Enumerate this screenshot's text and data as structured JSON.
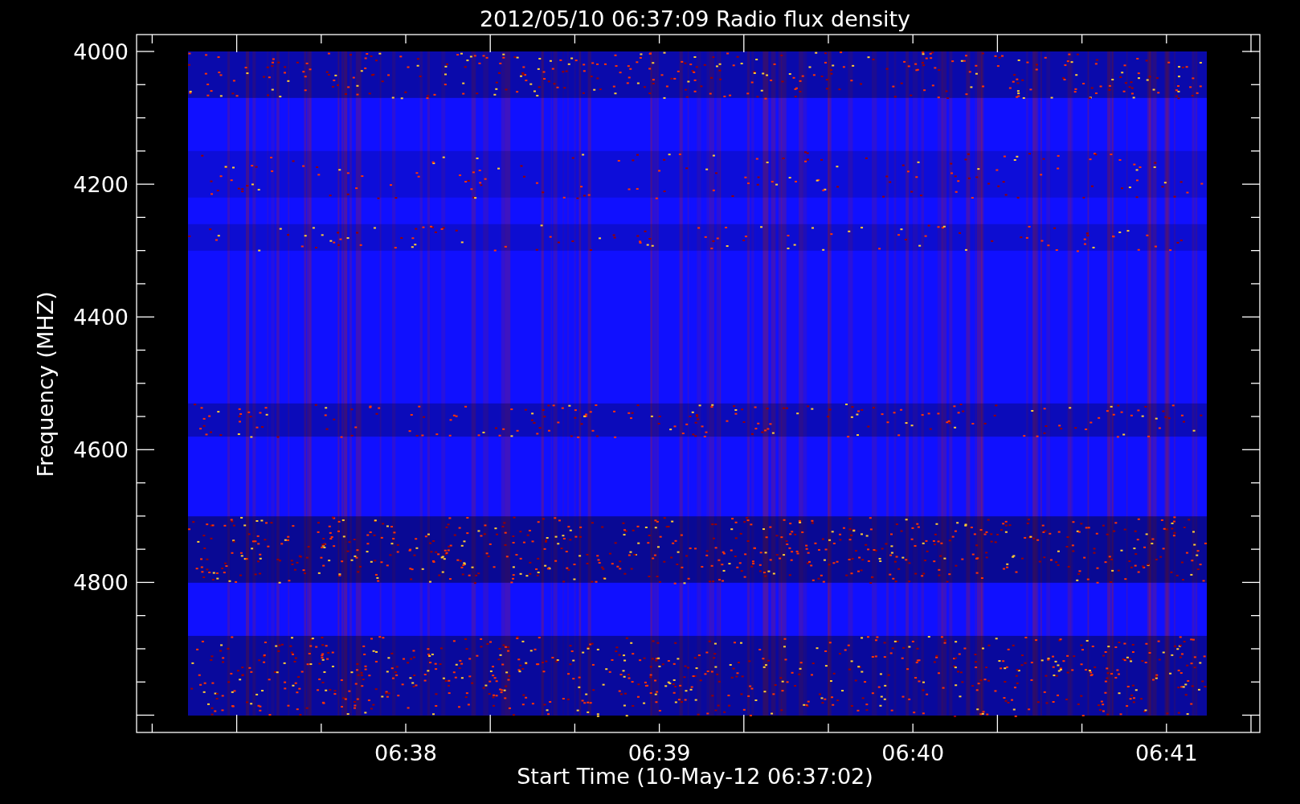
{
  "title": "2012/05/10 06:37:09 Radio flux density",
  "y_axis": {
    "label": "Frequency (MHZ)",
    "ticks": [
      "4000",
      "4200",
      "4400",
      "4600",
      "4800"
    ]
  },
  "x_axis": {
    "label": "Start Time (10-May-12 06:37:02)",
    "ticks": [
      "06:38",
      "06:39",
      "06:40",
      "06:41"
    ]
  }
}
